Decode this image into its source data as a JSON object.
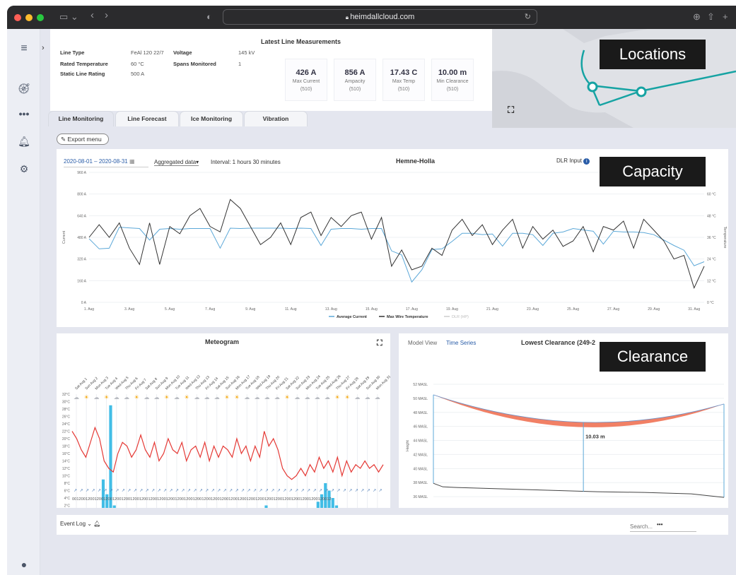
{
  "browser": {
    "url": "heimdallcloud.com"
  },
  "line_info": {
    "title_label": "",
    "items": [
      {
        "k": "Line Type",
        "v": "FeAl 120 22/7"
      },
      {
        "k": "Rated Temperature",
        "v": "60 °C"
      },
      {
        "k": "Static Line Rating",
        "v": "500 A"
      },
      {
        "k": "Voltage",
        "v": "145 kV"
      },
      {
        "k": "Spans Monitored",
        "v": "1"
      }
    ]
  },
  "measurements": {
    "title": "Latest Line Measurements",
    "cards": [
      {
        "value": "426 A",
        "label": "Max Current",
        "sub": "(510)"
      },
      {
        "value": "856 A",
        "label": "Ampacity",
        "sub": "(510)"
      },
      {
        "value": "17.43 C",
        "label": "Max Temp",
        "sub": "(510)"
      },
      {
        "value": "10.00 m",
        "label": "Min Clearance",
        "sub": "(510)"
      }
    ]
  },
  "tabs": [
    "Line Monitoring",
    "Line Forecast",
    "Ice Monitoring",
    "Vibration"
  ],
  "export_label": "Export menu",
  "overlays": {
    "locations": "Locations",
    "capacity": "Capacity",
    "clearance": "Clearance"
  },
  "capacity": {
    "date_range": "2020-08-01 – 2020-08-31",
    "aggregation": "Aggregated data",
    "interval": "Interval: 1 hours 30 minutes",
    "title": "Hemne-Holla",
    "dlr_input": "DLR Input"
  },
  "meteogram": {
    "title": "Meteogram",
    "hours": "00120012001200120012001200120012001200120012001200120012001200120012001200120012001200120012001200120012001200120012"
  },
  "clearance": {
    "tab_model": "Model View",
    "tab_series": "Time Series",
    "title": "Lowest Clearance (249-2",
    "value_label": "10.03 m"
  },
  "event_log": {
    "label": "Event Log",
    "more": "•••",
    "search_placeholder": "Search..."
  },
  "colors": {
    "accent": "#16a3a3",
    "current": "#5ca8d8",
    "temp": "#333333",
    "red": "#e53935",
    "sag": "#ef6a4a"
  },
  "chart_data": [
    {
      "type": "line",
      "title": "Hemne-Holla",
      "xlabel": "",
      "ylabel": "Current",
      "y2label": "Temperature",
      "x_ticks": [
        "1. Aug",
        "3. Aug",
        "5. Aug",
        "7. Aug",
        "9. Aug",
        "11. Aug",
        "13. Aug",
        "15. Aug",
        "17. Aug",
        "19. Aug",
        "21. Aug",
        "23. Aug",
        "25. Aug",
        "27. Aug",
        "29. Aug",
        "31. Aug"
      ],
      "y_ticks": [
        "0 A",
        "160 A",
        "320 A",
        "480 A",
        "640 A",
        "800 A",
        "960 A"
      ],
      "y2_ticks": [
        "0 °C",
        "12 °C",
        "24 °C",
        "36 °C",
        "48 °C",
        "60 °C"
      ],
      "ylim": [
        0,
        960
      ],
      "y2lim": [
        0,
        72
      ],
      "xlim": [
        1,
        31.5
      ],
      "series": [
        {
          "name": "Average Current",
          "unit": "A",
          "x": [
            1,
            1.5,
            2,
            2.5,
            3,
            3.5,
            4,
            4.5,
            5,
            5.5,
            6,
            6.5,
            7,
            7.5,
            8,
            8.5,
            9,
            9.5,
            10,
            10.5,
            11,
            11.5,
            12,
            12.5,
            13,
            13.5,
            14,
            14.5,
            15,
            15.5,
            16,
            16.5,
            17,
            17.5,
            18,
            18.5,
            19,
            19.5,
            20,
            20.5,
            21,
            21.5,
            22,
            22.5,
            23,
            23.5,
            24,
            24.5,
            25,
            25.5,
            26,
            26.5,
            27,
            27.5,
            28,
            28.5,
            29,
            29.5,
            30,
            30.5,
            31,
            31.5
          ],
          "values": [
            470,
            395,
            400,
            555,
            550,
            545,
            460,
            540,
            545,
            540,
            545,
            545,
            545,
            400,
            548,
            545,
            548,
            548,
            548,
            548,
            545,
            548,
            545,
            420,
            540,
            545,
            545,
            540,
            545,
            545,
            380,
            350,
            150,
            240,
            390,
            395,
            450,
            510,
            510,
            500,
            505,
            415,
            510,
            510,
            500,
            420,
            510,
            520,
            545,
            535,
            525,
            430,
            525,
            520,
            520,
            515,
            500,
            460,
            420,
            385,
            270,
            300
          ]
        },
        {
          "name": "Max Wire Temperature",
          "unit": "°C",
          "x": [
            1,
            1.5,
            2,
            2.5,
            3,
            3.5,
            4,
            4.5,
            5,
            5.5,
            6,
            6.5,
            7,
            7.5,
            8,
            8.5,
            9,
            9.5,
            10,
            10.5,
            11,
            11.5,
            12,
            12.5,
            13,
            13.5,
            14,
            14.5,
            15,
            15.5,
            16,
            16.5,
            17,
            17.5,
            18,
            18.5,
            19,
            19.5,
            20,
            20.5,
            21,
            21.5,
            22,
            22.5,
            23,
            23.5,
            24,
            24.5,
            25,
            25.5,
            26,
            26.5,
            27,
            27.5,
            28,
            28.5,
            29,
            29.5,
            30,
            30.5,
            31,
            31.5
          ],
          "values": [
            36,
            43,
            36,
            44,
            30,
            21,
            44,
            21,
            42,
            38,
            48,
            52,
            42,
            39,
            57,
            52,
            42,
            32,
            36,
            44,
            32,
            47,
            50,
            37,
            47,
            42,
            48,
            50,
            35,
            47,
            20,
            29,
            18,
            20,
            30,
            26,
            40,
            46,
            37,
            43,
            32,
            40,
            46,
            30,
            42,
            35,
            40,
            31,
            34,
            42,
            28,
            42,
            40,
            45,
            30,
            46,
            40,
            34,
            24,
            26,
            8,
            20
          ]
        },
        {
          "name": "DLR (HP)",
          "values": []
        }
      ]
    },
    {
      "type": "line",
      "title": "Meteogram",
      "ylabel": "°C",
      "y_ticks": [
        "0°C",
        "2°C",
        "4°C",
        "6°C",
        "8°C",
        "10°C",
        "12°C",
        "14°C",
        "16°C",
        "18°C",
        "20°C",
        "22°C",
        "24°C",
        "26°C",
        "28°C",
        "30°C",
        "32°C"
      ],
      "ylim": [
        0,
        32
      ],
      "day_labels": [
        "Sat Aug 1",
        "Sun Aug 2",
        "Mon Aug 3",
        "Tue Aug 4",
        "Wed Aug 5",
        "Thu Aug 6",
        "Fri Aug 7",
        "Sat Aug 8",
        "Sun Aug 9",
        "Mon Aug 10",
        "Tue Aug 11",
        "Wed Aug 12",
        "Thu Aug 13",
        "Fri Aug 14",
        "Sat Aug 15",
        "Sun Aug 16",
        "Mon Aug 17",
        "Tue Aug 18",
        "Wed Aug 19",
        "Thu Aug 20",
        "Fri Aug 21",
        "Sat Aug 22",
        "Sun Aug 23",
        "Mon Aug 24",
        "Tue Aug 25",
        "Wed Aug 26",
        "Thu Aug 27",
        "Fri Aug 28",
        "Sat Aug 29",
        "Sun Aug 30",
        "Mon Aug 31"
      ],
      "series": [
        {
          "name": "Temperature",
          "values": [
            22,
            20,
            17,
            15,
            19,
            23,
            20,
            14,
            12,
            11,
            16,
            19,
            18,
            15,
            17,
            21,
            17,
            15,
            19,
            14,
            16,
            20,
            17,
            16,
            19,
            14,
            17,
            18,
            15,
            19,
            14,
            18,
            15,
            18,
            17,
            15,
            20,
            16,
            18,
            14,
            18,
            15,
            22,
            18,
            20,
            17,
            12,
            10,
            9,
            10,
            12,
            10,
            13,
            11,
            15,
            12,
            14,
            11,
            15,
            10,
            14,
            11,
            13,
            12,
            14,
            12,
            13,
            11,
            13
          ]
        },
        {
          "name": "Precipitation",
          "values": [
            0,
            0,
            0,
            0,
            0,
            0,
            0,
            0,
            9,
            5,
            29,
            2,
            0,
            0,
            0,
            0,
            0,
            0,
            0,
            0,
            0,
            0,
            0,
            0,
            0,
            0,
            0,
            0,
            0,
            0,
            0,
            0,
            0,
            0,
            0,
            0,
            0,
            0,
            0,
            0,
            0,
            0,
            0,
            0,
            0,
            0,
            0,
            0,
            0,
            0,
            0,
            0,
            2,
            0,
            0,
            0,
            0,
            0,
            0,
            0,
            0,
            0,
            0,
            0,
            0,
            1,
            3,
            5,
            8,
            6,
            4,
            2,
            1,
            0,
            0,
            0,
            0,
            0,
            0,
            0,
            0,
            0,
            0,
            0
          ]
        }
      ]
    },
    {
      "type": "line",
      "title": "Lowest Clearance (249-2",
      "xlabel": "",
      "ylabel": "Height",
      "x_ticks": [
        "0 m",
        "20 m",
        "40 m",
        "60 m",
        "80 m",
        "100 m",
        "120 m"
      ],
      "y_ticks": [
        "34 MASL",
        "36 MASL",
        "38 MASL",
        "40 MASL",
        "42 MASL",
        "44 MASL",
        "46 MASL",
        "48 MASL",
        "50 MASL",
        "52 MASL"
      ],
      "xlim": [
        0,
        124
      ],
      "ylim": [
        34,
        52.5
      ],
      "series": [
        {
          "name": "CurrentSag",
          "x": [
            0,
            124
          ],
          "values": [
            50.5,
            49.2
          ],
          "min_point": [
            64,
            46.6
          ]
        },
        {
          "name": "Ground",
          "x": [
            0,
            4,
            10,
            30,
            50,
            70,
            90,
            110,
            124
          ],
          "values": [
            37.9,
            37.4,
            37.3,
            37.1,
            36.9,
            36.7,
            36.6,
            36.4,
            35.9
          ]
        },
        {
          "name": "MinMax",
          "x": [
            0,
            124
          ],
          "values": [
            50.5,
            49.2
          ],
          "min_lower": [
            64,
            45.9
          ]
        }
      ],
      "annotation": "10.03 m"
    }
  ]
}
